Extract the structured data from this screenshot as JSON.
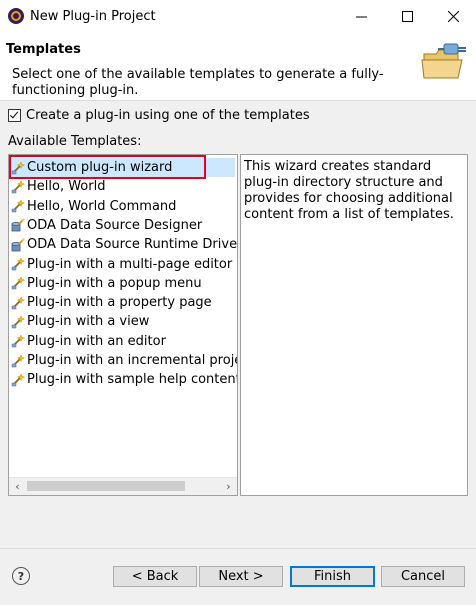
{
  "window": {
    "title": "New Plug-in Project"
  },
  "header": {
    "title": "Templates",
    "description": "Select one of the available templates to generate a fully-functioning plug-in."
  },
  "options": {
    "use_template_label": "Create a plug-in using one of the templates",
    "use_template_checked": true
  },
  "templates": {
    "label": "Available Templates:",
    "items": [
      {
        "label": "Custom plug-in wizard",
        "icon": "wizard-icon",
        "selected": true
      },
      {
        "label": "Hello, World",
        "icon": "wizard-icon"
      },
      {
        "label": "Hello, World Command",
        "icon": "wizard-icon"
      },
      {
        "label": "ODA Data Source Designer",
        "icon": "oda-icon"
      },
      {
        "label": "ODA Data Source Runtime Driver",
        "icon": "oda-icon"
      },
      {
        "label": "Plug-in with a multi-page editor",
        "icon": "wizard-icon"
      },
      {
        "label": "Plug-in with a popup menu",
        "icon": "wizard-icon"
      },
      {
        "label": "Plug-in with a property page",
        "icon": "wizard-icon"
      },
      {
        "label": "Plug-in with a view",
        "icon": "wizard-icon"
      },
      {
        "label": "Plug-in with an editor",
        "icon": "wizard-icon"
      },
      {
        "label": "Plug-in with an incremental project b",
        "icon": "wizard-icon"
      },
      {
        "label": "Plug-in with sample help content",
        "icon": "wizard-icon"
      }
    ],
    "description": "This wizard creates standard plug-in directory structure and provides for choosing additional content from a list of templates."
  },
  "buttons": {
    "back": "< Back",
    "next": "Next >",
    "finish": "Finish",
    "cancel": "Cancel"
  },
  "colors": {
    "selection": "#cce8ff",
    "highlight_border": "#e0001b",
    "default_button_border": "#0078d7"
  }
}
